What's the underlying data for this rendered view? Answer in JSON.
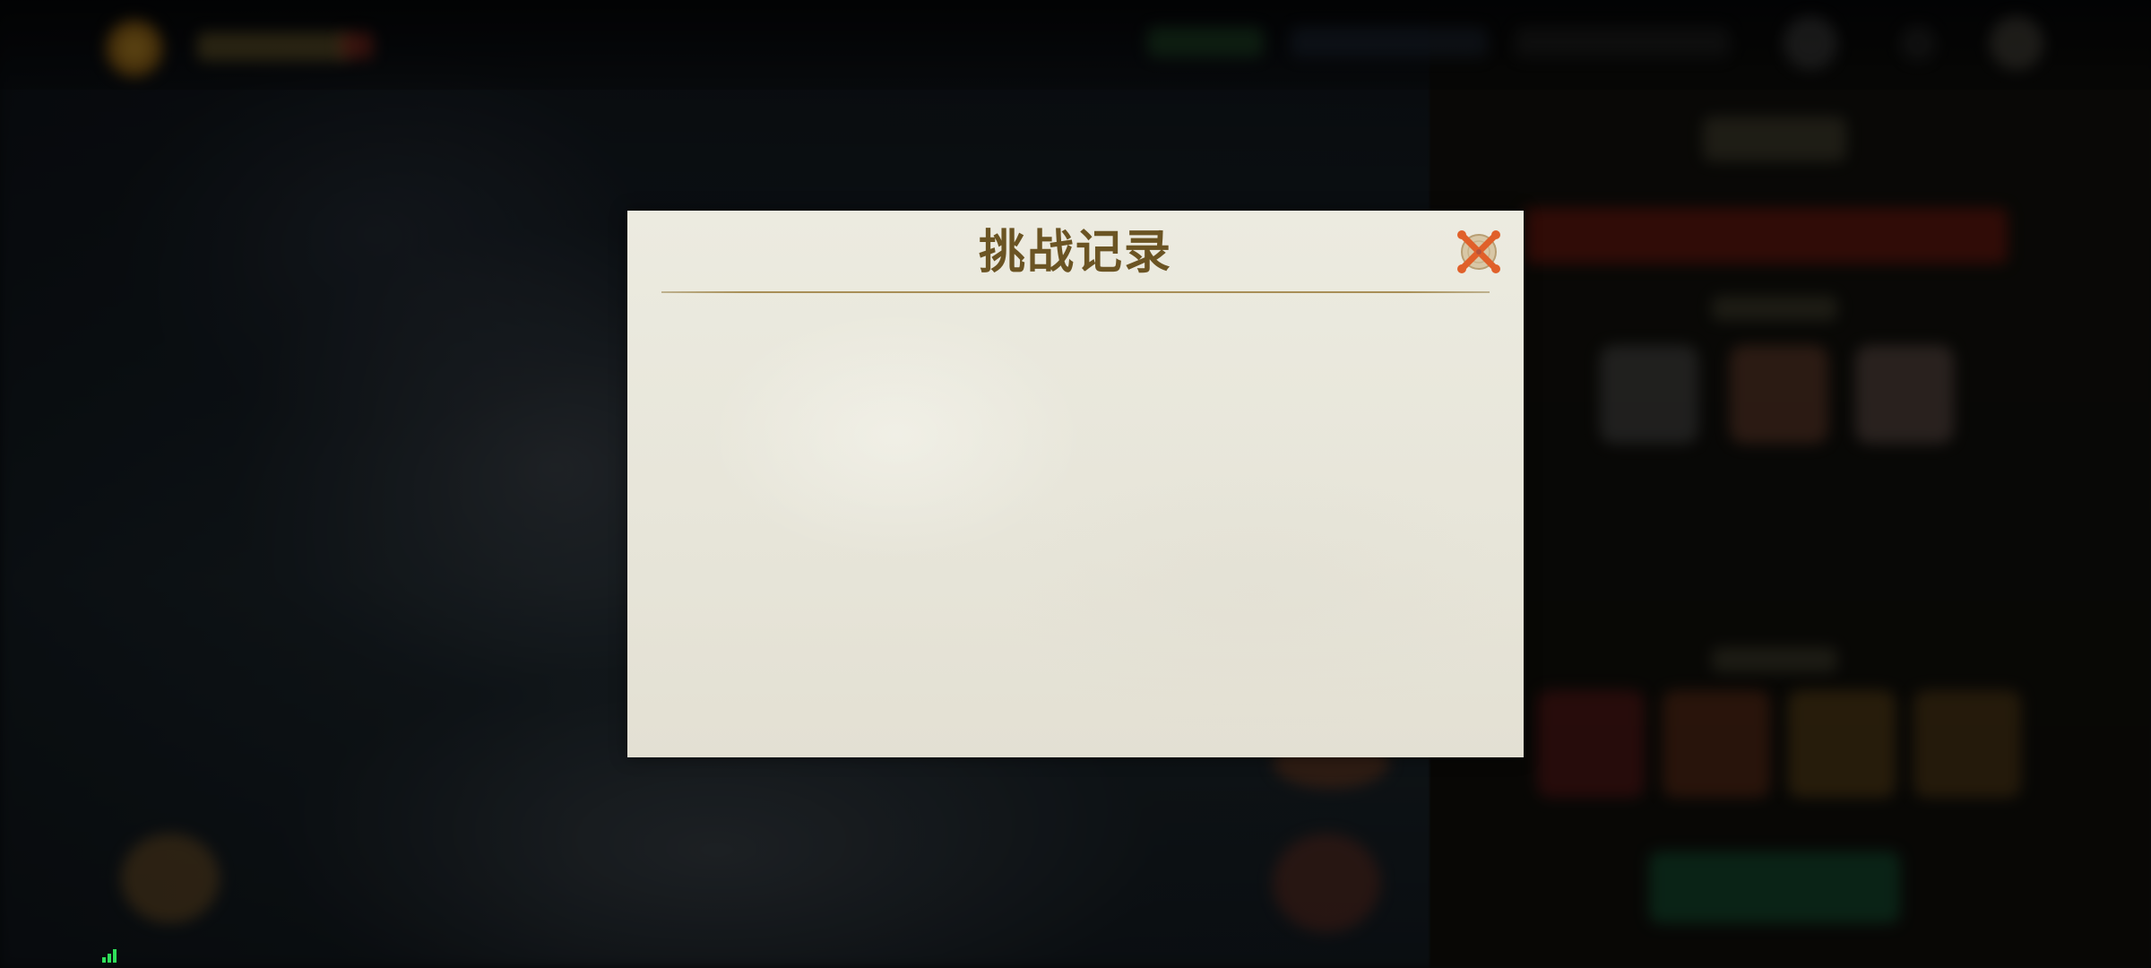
{
  "modal": {
    "title": "挑战记录",
    "close_icon": "close-x-icon",
    "records": []
  },
  "hud": {
    "signal_icon": "network-signal-icon",
    "signal_color": "#2fe05a"
  },
  "colors": {
    "modal_background": "#ecebe0",
    "title_color": "#6b5423",
    "divider_color": "#a88f57",
    "close_accent": "#e0602a"
  }
}
